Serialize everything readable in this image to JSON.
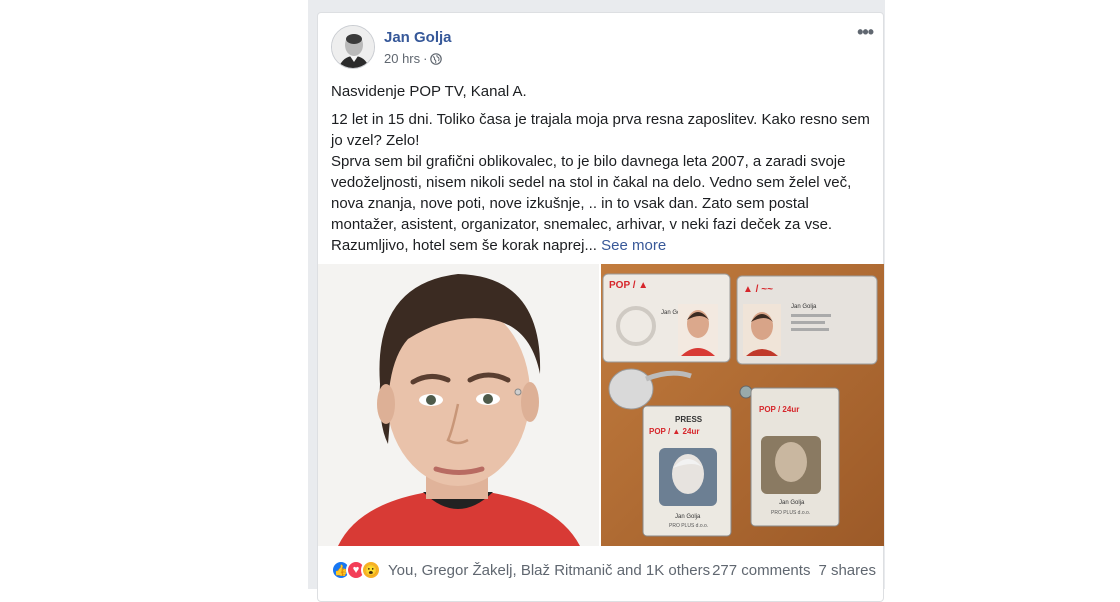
{
  "post": {
    "author": "Jan Golja",
    "time": "20 hrs",
    "privacy_icon": "globe-icon",
    "menu_icon": "more-options-icon",
    "text": {
      "line1": "Nasvidenje POP TV, Kanal A.",
      "para2": "12 let in 15 dni. Toliko časa je trajala moja prva resna zaposlitev. Kako resno sem jo vzel? Zelo!",
      "para3": "Sprva sem bil grafični oblikovalec, to je bilo davnega leta 2007, a zaradi svoje vedoželjnosti, nisem nikoli sedel na stol in čakal na delo. Vedno sem želel več, nova znanja, nove poti, nove izkušnje, .. in to vsak dan. Zato sem postal montažer, asistent, organizator, snemalec, arhivar, v neki fazi deček za vse. Razumljivo, hotel sem še korak naprej...",
      "see_more": "See more"
    },
    "photos": {
      "left_alt": "portrait photo",
      "right_alt": "POP TV press ID badges",
      "badges": {
        "card1_brand": "POP / ▲",
        "card1_name": "Jan Golja",
        "card2_name": "Jan Golja",
        "press_label": "PRESS",
        "press1_brand": "POP / ▲ 24ur",
        "press2_brand": "POP / 24ur",
        "press_name": "Jan Golja",
        "press_sub": "PRO PLUS d.o.o."
      }
    },
    "footer": {
      "reaction_icons": [
        "like-icon",
        "love-icon",
        "wow-icon"
      ],
      "reaction_names": "You, Gregor Žakelj, Blaž Ritmanič and 1K others",
      "comments": "277 comments",
      "shares": "7 shares"
    },
    "colors": {
      "author_link": "#365899",
      "see_more": "#385898",
      "like": "#1877f2",
      "love": "#f33e58",
      "wow": "#f7b125"
    }
  }
}
